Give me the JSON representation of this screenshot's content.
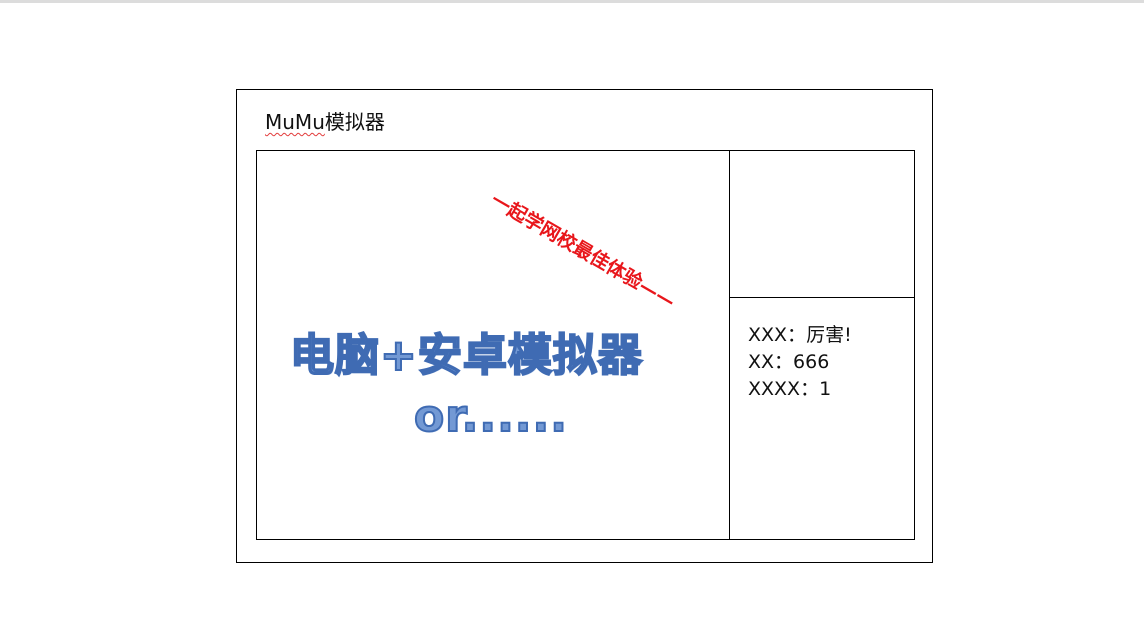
{
  "document": {
    "title_underlined": "MuMu",
    "title_rest": "模拟器",
    "banner": "一起学网校最佳体验——",
    "wordart_line1": "电脑+安卓模拟器",
    "wordart_line2": "or......",
    "info": [
      {
        "key": "XXX：",
        "value": "厉害!"
      },
      {
        "key": "XX：",
        "value": "666"
      },
      {
        "key": "XXXX：",
        "value": "1"
      }
    ]
  },
  "colors": {
    "banner": "#e8161b",
    "wordart_fill": "#7399d4",
    "wordart_stroke": "#3f6bb3",
    "spellcheck": "#e23b3b"
  }
}
